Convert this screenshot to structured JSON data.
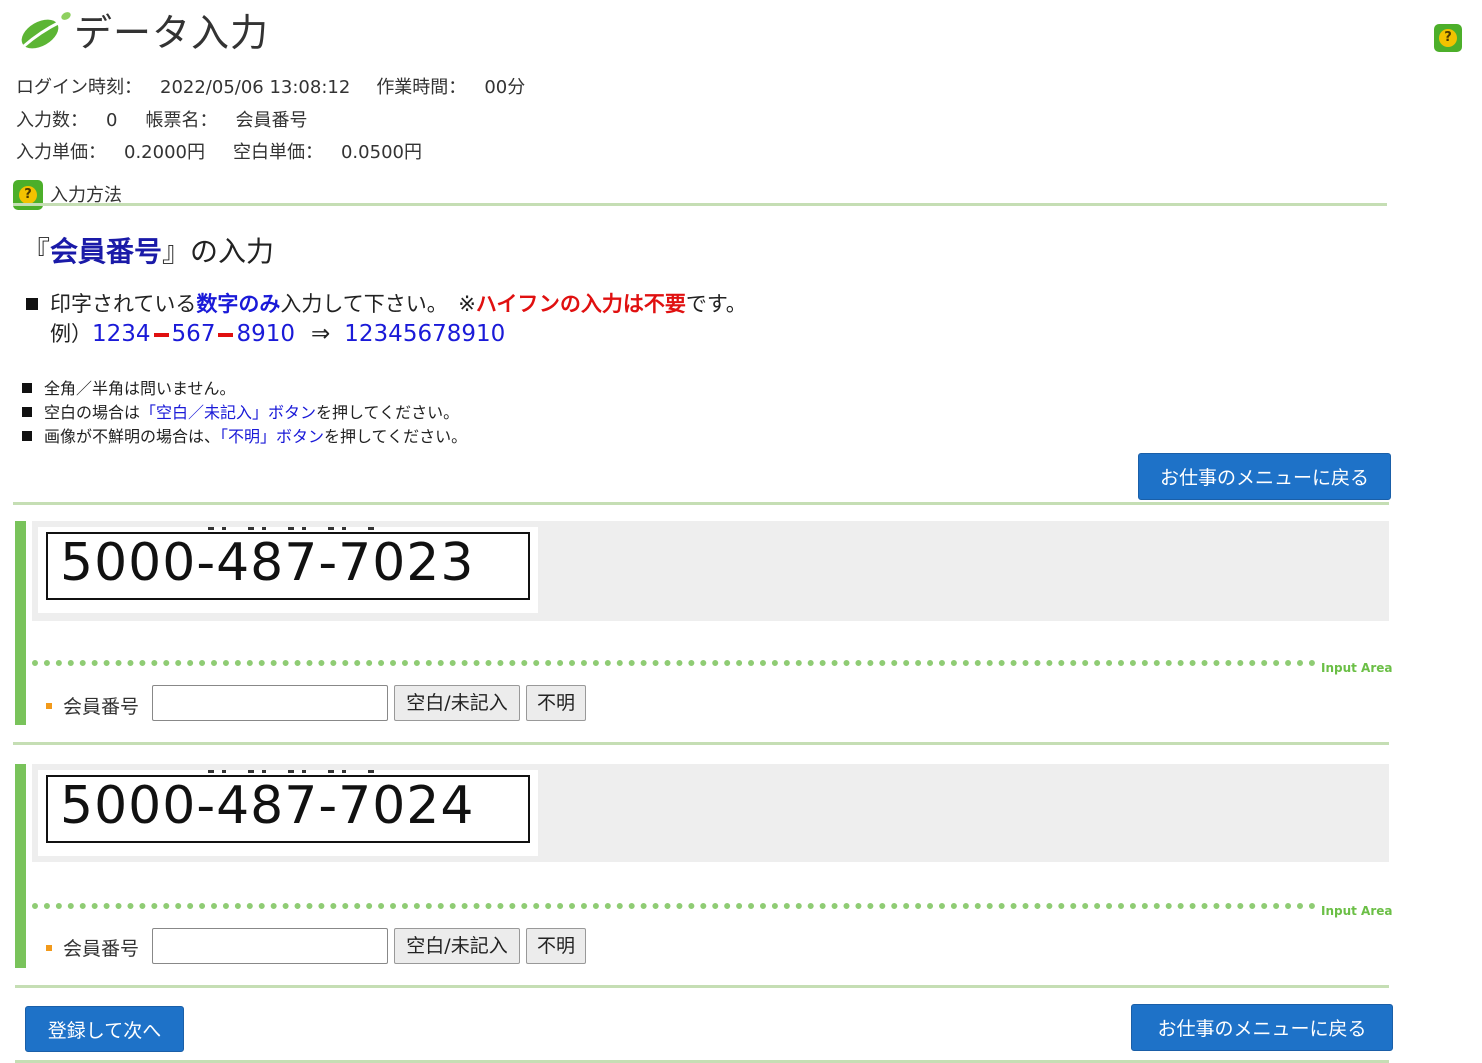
{
  "header": {
    "title": "データ入力",
    "logo_icon": "leaf-logo",
    "help_icon": "question-help-icon"
  },
  "session": {
    "login_label": "ログイン時刻：",
    "login_value": "2022/05/06 13:08:12",
    "work_label": "作業時間：",
    "work_value": "00分",
    "count_label": "入力数：",
    "count_value": "0",
    "form_label": "帳票名：",
    "form_value": "会員番号",
    "unit_label": "入力単価：",
    "unit_value": "0.2000円",
    "blank_unit_label": "空白単価：",
    "blank_unit_value": "0.0500円"
  },
  "howto": {
    "label": "入力方法"
  },
  "instructions": {
    "heading_open": "『",
    "heading_field": "会員番号",
    "heading_close": "』の入力",
    "rule_prefix": "印字されている",
    "rule_emph": "数字のみ",
    "rule_mid": "入力して下さい。　※",
    "rule_warn": "ハイフンの入力は不要",
    "rule_suffix": "です。",
    "example_label": "例）",
    "example_part1": "1234",
    "example_part2": "567",
    "example_part3": "8910",
    "example_arrow": "⇒",
    "example_result": "12345678910",
    "note1": "全角／半角は問いません。",
    "note2_prefix": "空白の場合は",
    "note2_link": "「空白／未記入」ボタン",
    "note2_suffix": "を押してください。",
    "note3_prefix": "画像が不鮮明の場合は、",
    "note3_link": "「不明」ボタン",
    "note3_suffix": "を押してください。"
  },
  "buttons": {
    "back_to_menu": "お仕事のメニューに戻る",
    "register_next": "登録して次へ"
  },
  "entries": [
    {
      "image_text": "5000-487-7023",
      "area_label": "Input Area",
      "field_label": "会員番号",
      "value": "",
      "blank_button": "空白/未記入",
      "unknown_button": "不明"
    },
    {
      "image_text": "5000-487-7024",
      "area_label": "Input Area",
      "field_label": "会員番号",
      "value": "",
      "blank_button": "空白/未記入",
      "unknown_button": "不明"
    }
  ],
  "colors": {
    "accent_blue": "#1e72c8",
    "accent_green": "#79c35b",
    "warning_red": "#e01010",
    "emphasis_blue": "#1a1ad8"
  }
}
